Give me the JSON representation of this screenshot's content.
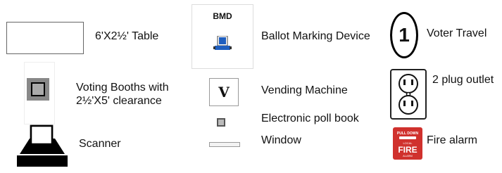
{
  "legend": {
    "table": {
      "label": "6'X2½' Table"
    },
    "bmd": {
      "symbol_text": "BMD",
      "label": "Ballot Marking Device"
    },
    "voter_travel": {
      "symbol_text": "1",
      "label": "Voter Travel"
    },
    "voting_booth": {
      "label_line1": "Voting Booths with",
      "label_line2": "2½'X5' clearance"
    },
    "vending": {
      "symbol_text": "V",
      "label": "Vending Machine"
    },
    "outlet": {
      "label": "2 plug outlet"
    },
    "poll_book": {
      "label": "Electronic poll book"
    },
    "scanner": {
      "label": "Scanner"
    },
    "window": {
      "label": "Window"
    },
    "fire_alarm": {
      "label": "Fire alarm",
      "sign_top": "PULL DOWN",
      "sign_local": "LOCAL",
      "sign_word": "FIRE",
      "sign_bottom": "ALARM"
    }
  },
  "colors": {
    "fire_red": "#d0312d",
    "bmd_blue": "#1f5fbf"
  }
}
